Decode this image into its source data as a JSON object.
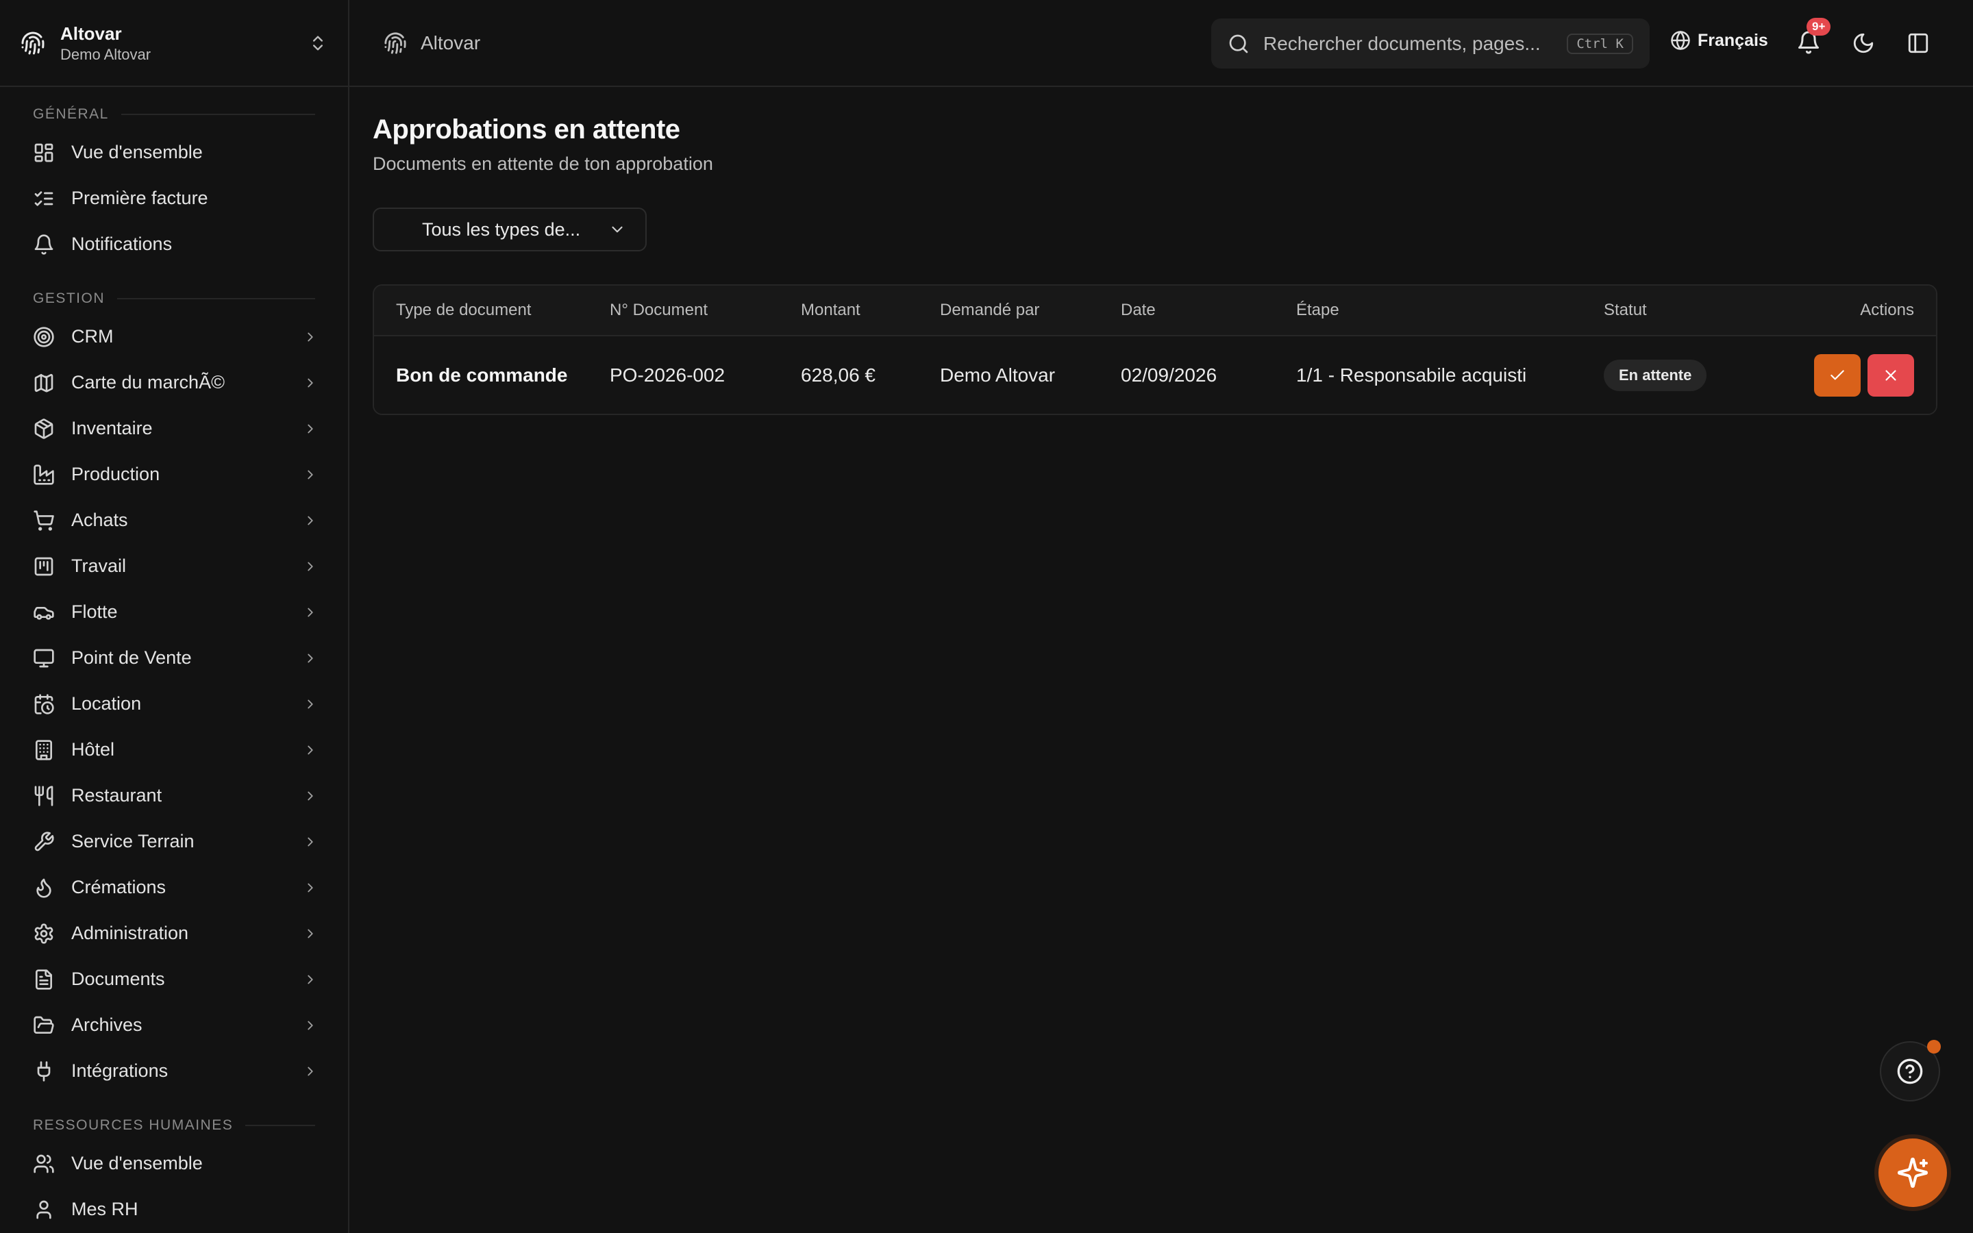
{
  "org": {
    "name": "Altovar",
    "subtitle": "Demo Altovar"
  },
  "breadcrumb": {
    "label": "Altovar"
  },
  "search": {
    "placeholder": "Rechercher documents, pages...",
    "shortcut": "Ctrl K"
  },
  "language": "Français",
  "notifications": {
    "count": "9+"
  },
  "sidebar": {
    "sections": [
      {
        "title": "Général",
        "items": [
          {
            "label": "Vue d'ensemble",
            "icon": "layout-dashboard-icon"
          },
          {
            "label": "Première facture",
            "icon": "list-checks-icon"
          },
          {
            "label": "Notifications",
            "icon": "bell-icon"
          }
        ]
      },
      {
        "title": "Gestion",
        "items": [
          {
            "label": "CRM",
            "icon": "target-icon"
          },
          {
            "label": "Carte du marchÃ©",
            "icon": "map-icon"
          },
          {
            "label": "Inventaire",
            "icon": "package-icon"
          },
          {
            "label": "Production",
            "icon": "factory-icon"
          },
          {
            "label": "Achats",
            "icon": "shopping-cart-icon"
          },
          {
            "label": "Travail",
            "icon": "kanban-icon"
          },
          {
            "label": "Flotte",
            "icon": "car-icon"
          },
          {
            "label": "Point de Vente",
            "icon": "monitor-icon"
          },
          {
            "label": "Location",
            "icon": "calendar-clock-icon"
          },
          {
            "label": "Hôtel",
            "icon": "building-icon"
          },
          {
            "label": "Restaurant",
            "icon": "utensils-icon"
          },
          {
            "label": "Service Terrain",
            "icon": "wrench-icon"
          },
          {
            "label": "Crémations",
            "icon": "flame-icon"
          },
          {
            "label": "Administration",
            "icon": "settings-icon"
          },
          {
            "label": "Documents",
            "icon": "file-text-icon"
          },
          {
            "label": "Archives",
            "icon": "folder-open-icon"
          },
          {
            "label": "Intégrations",
            "icon": "plug-icon"
          }
        ]
      },
      {
        "title": "Ressources humaines",
        "items": [
          {
            "label": "Vue d'ensemble",
            "icon": "users-icon"
          },
          {
            "label": "Mes RH",
            "icon": "user-icon"
          }
        ]
      }
    ]
  },
  "page": {
    "title": "Approbations en attente",
    "subtitle": "Documents en attente de ton approbation",
    "filter": "Tous les types de..."
  },
  "table": {
    "headers": [
      "Type de document",
      "N° Document",
      "Montant",
      "Demandé par",
      "Date",
      "Étape",
      "Statut",
      "Actions"
    ],
    "rows": [
      {
        "type": "Bon de commande",
        "number": "PO-2026-002",
        "amount": "628,06 €",
        "requested_by": "Demo Altovar",
        "date": "02/09/2026",
        "step": "1/1 - Responsabile acquisti",
        "status": "En attente"
      }
    ]
  },
  "colors": {
    "accent": "#d9611a",
    "danger": "#e5484d",
    "background": "#121212"
  }
}
